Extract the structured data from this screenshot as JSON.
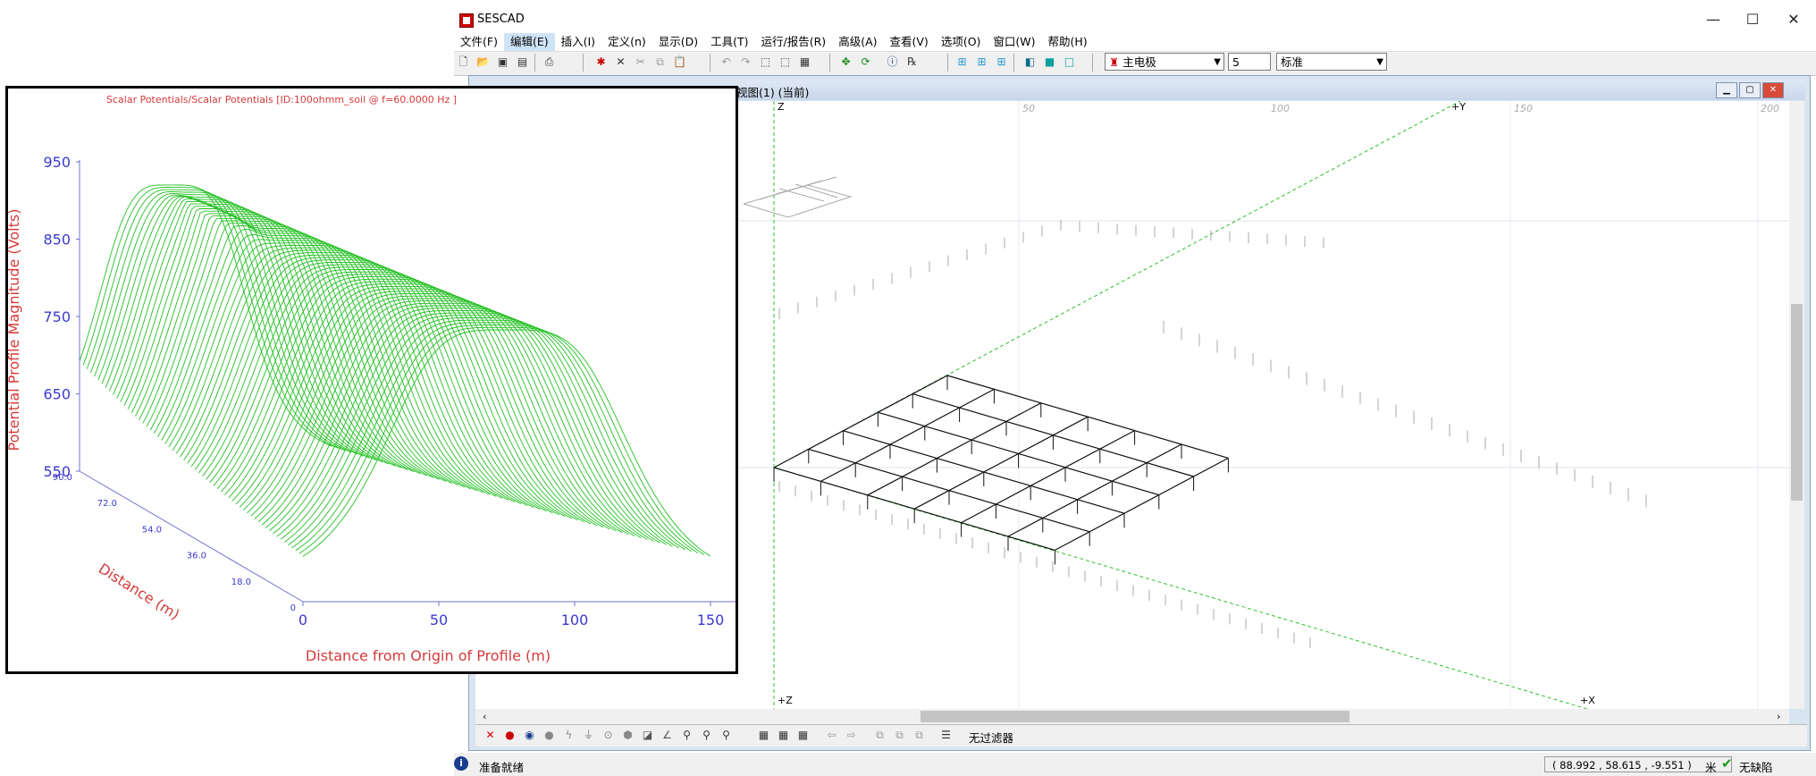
{
  "window": {
    "title": "SESCAD",
    "minimize": "—",
    "maximize": "☐",
    "close": "✕"
  },
  "menu": [
    "文件(F)",
    "编辑(E)",
    "插入(I)",
    "定义(n)",
    "显示(D)",
    "工具(T)",
    "运行/报告(R)",
    "高级(A)",
    "查看(V)",
    "选项(O)",
    "窗口(W)",
    "帮助(H)"
  ],
  "toolbar": {
    "icons": [
      "new-file-icon",
      "open-folder-icon",
      "save-icon",
      "save-all-icon",
      "print-icon",
      "cut-color-icon",
      "delete-icon",
      "scissors-icon",
      "copy-icon",
      "paste-icon",
      "undo-icon",
      "redo-icon",
      "select-icon",
      "deselect-icon",
      "grid-select-icon",
      "move-icon",
      "rotate-icon",
      "info-icon",
      "rx-icon",
      "view1-icon",
      "view2-icon",
      "view3-icon",
      "cube-icon",
      "square-icon",
      "square2-icon"
    ],
    "electrode_combo": "主电极",
    "number_field": "5",
    "style_combo": "标准"
  },
  "child_window": {
    "title": "视图(1)  (当前)"
  },
  "viewport_labels": {
    "z_top": "Z",
    "y_axis": "+Y",
    "z_bottom": "+Z",
    "x_axis": "+X",
    "ruler": [
      "50",
      "100",
      "150",
      "200"
    ]
  },
  "bottom_toolbar": {
    "filter": "无过滤器"
  },
  "status": {
    "ready": "准备就绪",
    "coords": "(  88.992  ,   58.615  ,   -9.551   )",
    "unit": "米",
    "nofault": "无缺陷",
    "info_icon": "i"
  },
  "chart": {
    "title": "Scalar Potentials/Scalar Potentials [ID:100ohmm_soil  @ f=60.0000 Hz ]",
    "ylabel": "Potential Profile Magnitude (Volts)",
    "xlabel": "Distance from Origin of Profile (m)",
    "zlabel": "Distance (m)",
    "line_color": "#22c022",
    "label_color": "#d43a3a",
    "tick_color": "#3a3ad0"
  },
  "chart_data": {
    "type": "line",
    "title": "Scalar Potentials/Scalar Potentials [ID:100ohmm_soil  @ f=60.0000 Hz ]",
    "xlabel": "Distance from Origin of Profile (m)",
    "ylabel": "Potential Profile Magnitude (Volts)",
    "zlabel": "Distance (m)",
    "x_ticks": [
      "0",
      "50",
      "100",
      "150"
    ],
    "y_ticks": [
      "550",
      "650",
      "750",
      "850",
      "950"
    ],
    "z_ticks": [
      "0",
      "18.0",
      "36.0",
      "54.0",
      "72.0",
      "90.0"
    ],
    "xlim": [
      0,
      150
    ],
    "ylim": [
      550,
      950
    ],
    "zlim": [
      0,
      90
    ],
    "surface": "3D wireframe of profile potentials; plateau ~920 V over grid area, falling to ~550 V at profile ends"
  }
}
